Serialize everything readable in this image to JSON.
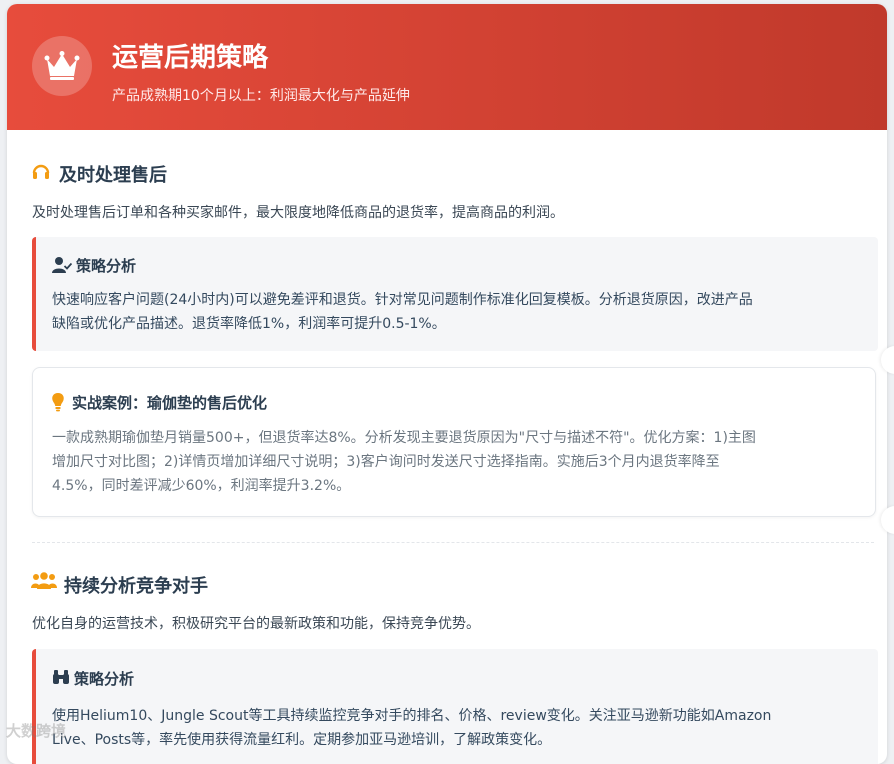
{
  "header": {
    "title": "运营后期策略",
    "subtitle": "产品成熟期10个月以上：利润最大化与产品延伸",
    "icon": "crown-icon"
  },
  "section1": {
    "icon": "headset-icon",
    "title": "及时处理售后",
    "description": "及时处理售后订单和各种买家邮件，最大限度地降低商品的退货率，提高商品的利润。",
    "analysis": {
      "icon": "user-check-icon",
      "title": "策略分析",
      "lines": [
        "快速响应客户问题(24小时内)可以避免差评和退货。针对常见问题制作标准化回复模板。分析退货原因，改进产品",
        "缺陷或优化产品描述。退货率降低1%，利润率可提升0.5-1%。"
      ]
    },
    "case": {
      "icon": "lightbulb-icon",
      "title": "实战案例：瑜伽垫的售后优化",
      "lines": [
        "一款成熟期瑜伽垫月销量500+，但退货率达8%。分析发现主要退货原因为\"尺寸与描述不符\"。优化方案：1)主图",
        "增加尺寸对比图；2)详情页增加详细尺寸说明；3)客户询问时发送尺寸选择指南。实施后3个月内退货率降至",
        "4.5%，同时差评减少60%，利润率提升3.2%。"
      ]
    }
  },
  "section2": {
    "icon": "users-icon",
    "title": "持续分析竞争对手",
    "description": "优化自身的运营技术，积极研究平台的最新政策和功能，保持竞争优势。",
    "analysis": {
      "icon": "binoculars-icon",
      "title": "策略分析",
      "lines": [
        "使用Helium10、Jungle Scout等工具持续监控竞争对手的排名、价格、review变化。关注亚马逊新功能如Amazon",
        "Live、Posts等，率先使用获得流量红利。定期参加亚马逊培训，了解政策变化。"
      ]
    }
  },
  "watermark": "大数跨境",
  "colors": {
    "accent": "#e74c3c",
    "accent_dark": "#c0392b",
    "icon_orange": "#f39c12",
    "text_dark": "#2c3e50"
  }
}
